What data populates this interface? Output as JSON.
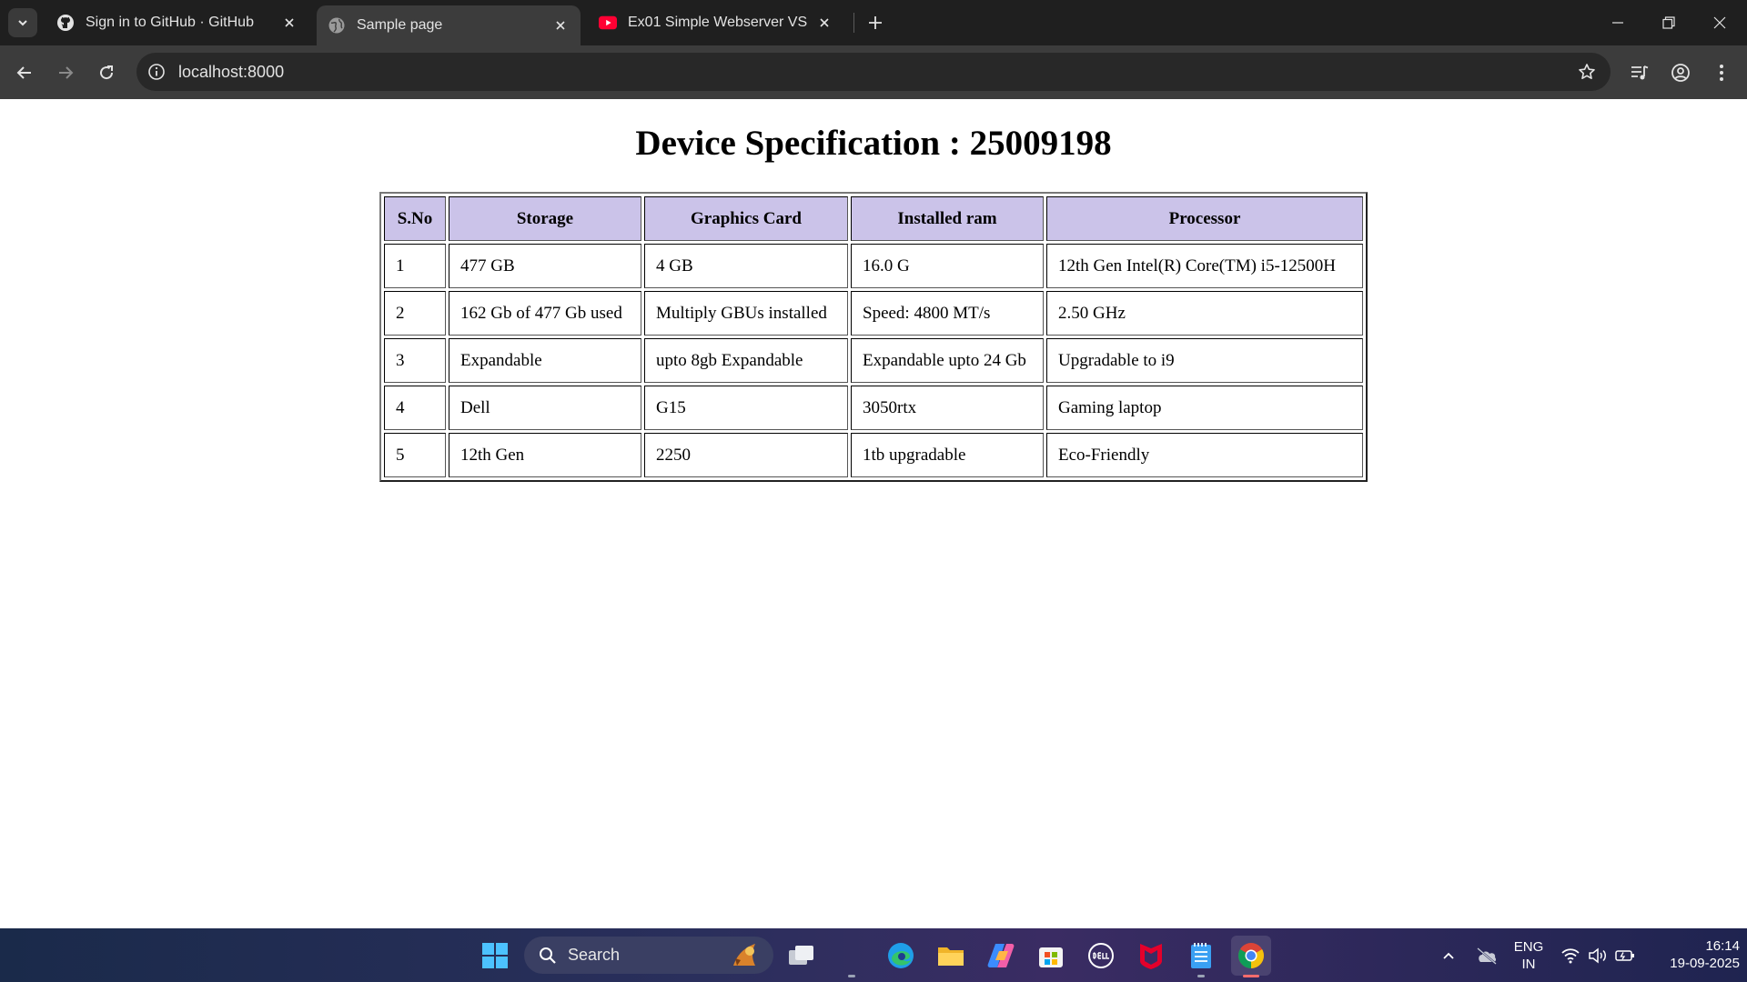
{
  "browser": {
    "tabs": [
      {
        "title": "Sign in to GitHub · GitHub",
        "icon": "github-icon"
      },
      {
        "title": "Sample page",
        "icon": "globe-icon",
        "active": true
      },
      {
        "title": "Ex01 Simple Webserver VS Code",
        "icon": "youtube-icon"
      }
    ],
    "url": "localhost:8000"
  },
  "page": {
    "heading": "Device Specification : 25009198",
    "table": {
      "headers": [
        "S.No",
        "Storage",
        "Graphics Card",
        "Installed ram",
        "Processor"
      ],
      "rows": [
        [
          "1",
          "477 GB",
          "4 GB",
          "16.0 G",
          "12th Gen Intel(R) Core(TM) i5-12500H"
        ],
        [
          "2",
          "162 Gb of 477 Gb used",
          "Multiply GBUs installed",
          "Speed: 4800 MT/s",
          "2.50 GHz"
        ],
        [
          "3",
          "Expandable",
          "upto 8gb Expandable",
          "Expandable upto 24 Gb",
          "Upgradable to i9"
        ],
        [
          "4",
          "Dell",
          "G15",
          "3050rtx",
          "Gaming laptop"
        ],
        [
          "5",
          "12th Gen",
          "2250",
          "1tb upgradable",
          "Eco-Friendly"
        ]
      ]
    },
    "header_bg": "#cbc3e9"
  },
  "taskbar": {
    "search_label": "Search",
    "lang_line1": "ENG",
    "lang_line2": "IN",
    "time": "16:14",
    "date": "19-09-2025"
  }
}
